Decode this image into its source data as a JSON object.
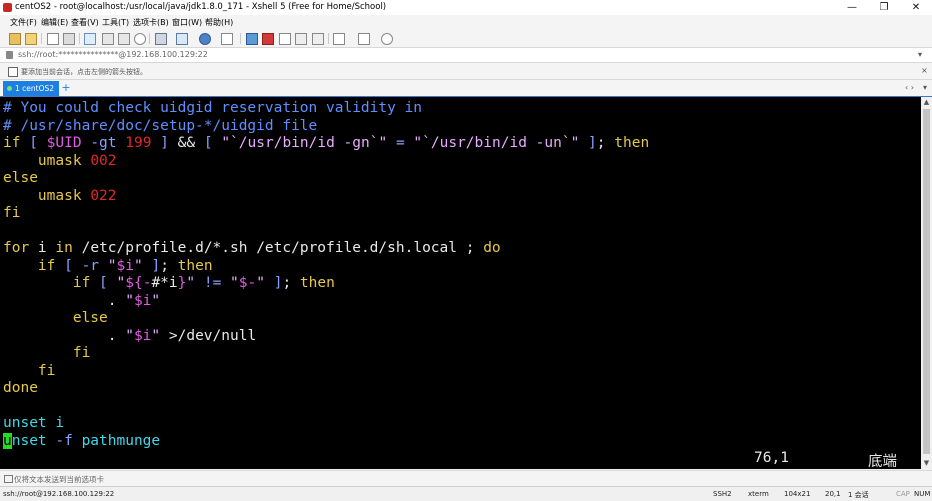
{
  "window": {
    "title": "centOS2 - root@localhost:/usr/local/java/jdk1.8.0_171 - Xshell 5 (Free for Home/School)"
  },
  "menu": [
    {
      "label": "文件(F)"
    },
    {
      "label": "编辑(E)"
    },
    {
      "label": "查看(V)"
    },
    {
      "label": "工具(T)"
    },
    {
      "label": "选项卡(B)"
    },
    {
      "label": "窗口(W)"
    },
    {
      "label": "帮助(H)"
    }
  ],
  "address": {
    "value": "ssh://root:***************@192.168.100.129:22"
  },
  "session_hint": "要添加当前会话，点击左侧的箭头按钮。",
  "tabs": [
    {
      "label": "1 centOS2"
    }
  ],
  "terminal": {
    "lines": [
      [
        {
          "t": "# You could check uidgid reservation validity in",
          "c": "comment"
        }
      ],
      [
        {
          "t": "# /usr/share/doc/setup-*/uidgid file",
          "c": "comment"
        }
      ],
      [
        {
          "t": "if",
          "c": "kw"
        },
        {
          "t": " [ ",
          "c": "op"
        },
        {
          "t": "$UID",
          "c": "var"
        },
        {
          "t": " -gt ",
          "c": "op"
        },
        {
          "t": "199",
          "c": "num"
        },
        {
          "t": " ] ",
          "c": "op"
        },
        {
          "t": "&& ",
          "c": "plain"
        },
        {
          "t": "[ ",
          "c": "op"
        },
        {
          "t": "\"`",
          "c": "str"
        },
        {
          "t": "/usr/bin/id -gn",
          "c": "str"
        },
        {
          "t": "`\"",
          "c": "str"
        },
        {
          "t": " = ",
          "c": "op"
        },
        {
          "t": "\"`",
          "c": "str"
        },
        {
          "t": "/usr/bin/id -un",
          "c": "str"
        },
        {
          "t": "`\"",
          "c": "str"
        },
        {
          "t": " ]",
          "c": "op"
        },
        {
          "t": "; ",
          "c": "plain"
        },
        {
          "t": "then",
          "c": "kw"
        }
      ],
      [
        {
          "t": "    umask ",
          "c": "kw"
        },
        {
          "t": "002",
          "c": "num"
        }
      ],
      [
        {
          "t": "else",
          "c": "kw"
        }
      ],
      [
        {
          "t": "    umask ",
          "c": "kw"
        },
        {
          "t": "022",
          "c": "num"
        }
      ],
      [
        {
          "t": "fi",
          "c": "kw"
        }
      ],
      [
        {
          "t": "",
          "c": "plain"
        }
      ],
      [
        {
          "t": "for",
          "c": "kw"
        },
        {
          "t": " i ",
          "c": "plain"
        },
        {
          "t": "in",
          "c": "kw"
        },
        {
          "t": " /etc/profile.d/*.sh /etc/profile.d/sh.local ; ",
          "c": "plain"
        },
        {
          "t": "do",
          "c": "kw"
        }
      ],
      [
        {
          "t": "    if",
          "c": "kw"
        },
        {
          "t": " [ -r ",
          "c": "op"
        },
        {
          "t": "\"",
          "c": "str"
        },
        {
          "t": "$i",
          "c": "var"
        },
        {
          "t": "\"",
          "c": "str"
        },
        {
          "t": " ]",
          "c": "op"
        },
        {
          "t": "; ",
          "c": "plain"
        },
        {
          "t": "then",
          "c": "kw"
        }
      ],
      [
        {
          "t": "        if",
          "c": "kw"
        },
        {
          "t": " [ ",
          "c": "op"
        },
        {
          "t": "\"",
          "c": "str"
        },
        {
          "t": "${-",
          "c": "var"
        },
        {
          "t": "#*i",
          "c": "plain"
        },
        {
          "t": "}",
          "c": "var"
        },
        {
          "t": "\"",
          "c": "str"
        },
        {
          "t": " != ",
          "c": "op"
        },
        {
          "t": "\"",
          "c": "str"
        },
        {
          "t": "$-",
          "c": "var"
        },
        {
          "t": "\"",
          "c": "str"
        },
        {
          "t": " ]",
          "c": "op"
        },
        {
          "t": "; ",
          "c": "plain"
        },
        {
          "t": "then",
          "c": "kw"
        }
      ],
      [
        {
          "t": "            . ",
          "c": "plain"
        },
        {
          "t": "\"",
          "c": "str"
        },
        {
          "t": "$i",
          "c": "var"
        },
        {
          "t": "\"",
          "c": "str"
        }
      ],
      [
        {
          "t": "        else",
          "c": "kw"
        }
      ],
      [
        {
          "t": "            . ",
          "c": "plain"
        },
        {
          "t": "\"",
          "c": "str"
        },
        {
          "t": "$i",
          "c": "var"
        },
        {
          "t": "\"",
          "c": "str"
        },
        {
          "t": " >/dev/null",
          "c": "plain"
        }
      ],
      [
        {
          "t": "        fi",
          "c": "kw"
        }
      ],
      [
        {
          "t": "    fi",
          "c": "kw"
        }
      ],
      [
        {
          "t": "done",
          "c": "kw"
        }
      ],
      [
        {
          "t": "",
          "c": "plain"
        }
      ],
      [
        {
          "t": "unset",
          "c": "cmd"
        },
        {
          "t": " i",
          "c": "cmd"
        }
      ],
      [
        {
          "t": "u",
          "c": "cursor"
        },
        {
          "t": "nset",
          "c": "cmd"
        },
        {
          "t": " -f ",
          "c": "op"
        },
        {
          "t": "pathmunge",
          "c": "cmd"
        }
      ]
    ],
    "status_position": "76,1",
    "status_at": "底端"
  },
  "compose_hint": "仅将文本发送到当前选项卡",
  "statusbar": {
    "connection": "ssh://root@192.168.100.129:22",
    "protocol": "SSH2",
    "term": "xterm",
    "size": "104x21",
    "cursor": "20,1",
    "sessions": "1 会话",
    "cap": "CAP",
    "num": "NUM"
  }
}
